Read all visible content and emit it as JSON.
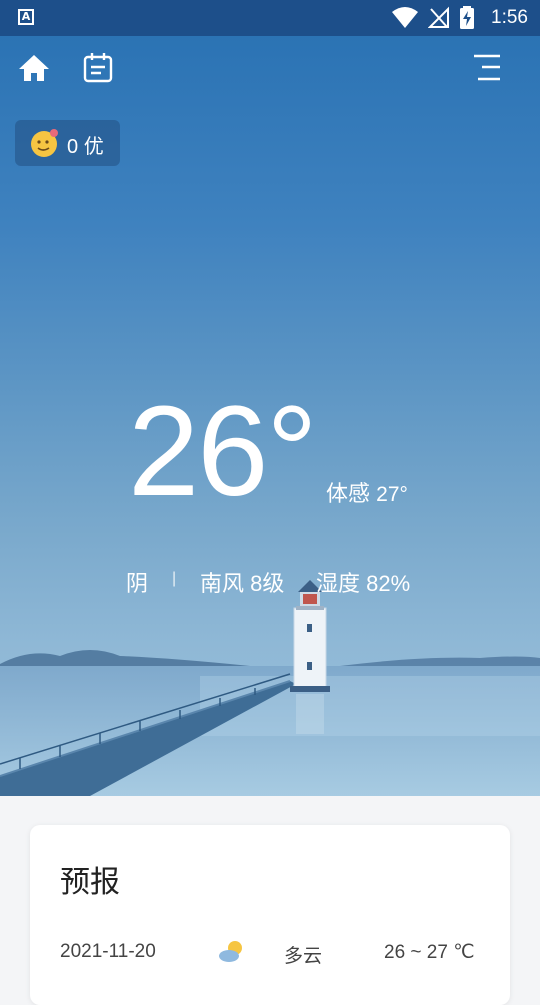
{
  "status_bar": {
    "time": "1:56",
    "app_icon_letter": "A"
  },
  "header": {
    "icons": [
      "home-icon",
      "calendar-icon",
      "menu-icon"
    ]
  },
  "aqi": {
    "value": "0",
    "level": "优"
  },
  "current": {
    "temperature": "26°",
    "feels_label": "体感",
    "feels_value": "27°",
    "condition": "阴",
    "separator": "|",
    "wind": "南风 8级",
    "humidity": "湿度 82%"
  },
  "forecast": {
    "title": "预报",
    "rows": [
      {
        "date": "2021-11-20",
        "icon": "partly-cloudy-icon",
        "condition": "多云",
        "range": "26 ~ 27 ℃"
      }
    ]
  },
  "colors": {
    "status_bar": "#1d4f8a",
    "sky_top": "#2b73b4",
    "sea": "#9ec3dd"
  }
}
